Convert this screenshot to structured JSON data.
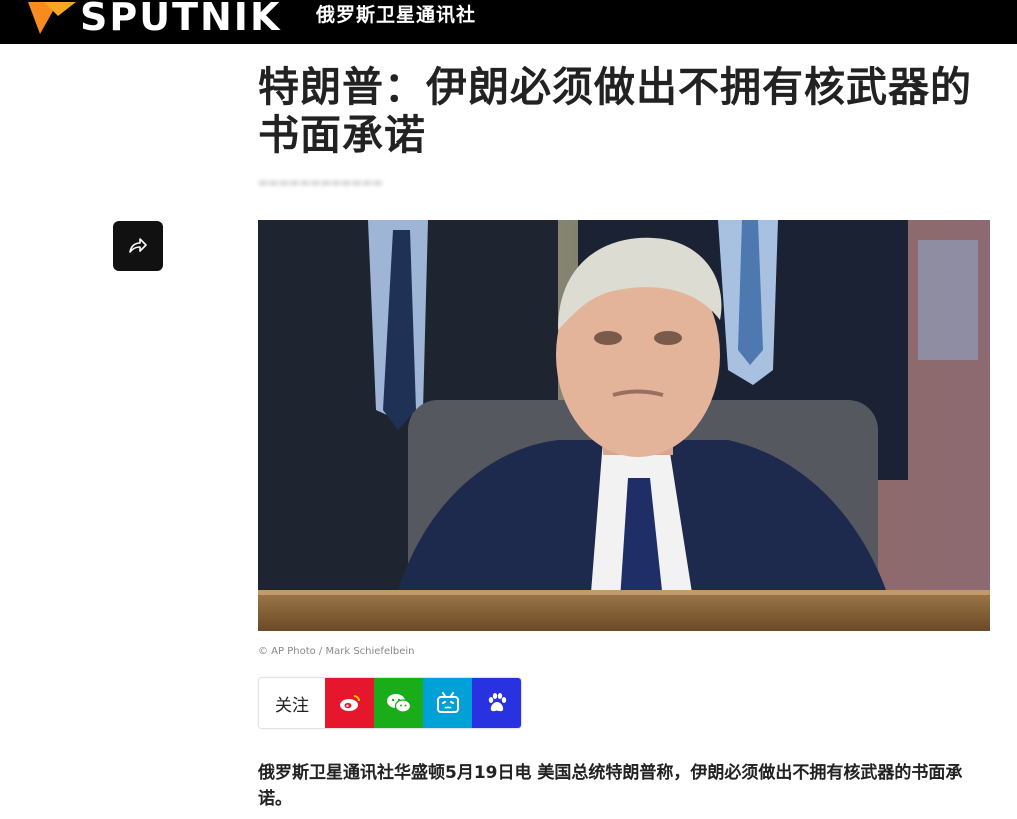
{
  "header": {
    "brand": "SPUTNIK",
    "brand_sub": "俄罗斯卫星通讯社",
    "accent_color": "#F68C1F"
  },
  "article": {
    "title": "特朗普：伊朗必须做出不拥有核武器的书面承诺",
    "photo_credit": "© AP Photo / Mark Schiefelbein",
    "lead": "俄罗斯卫星通讯社华盛顿5月19日电 美国总统特朗普称，伊朗必须做出不拥有核武器的书面承诺。"
  },
  "share": {
    "icon": "share-arrow-icon"
  },
  "social": {
    "follow_label": "关注",
    "buttons": [
      {
        "icon": "weibo-icon",
        "color": "#E6162D"
      },
      {
        "icon": "wechat-icon",
        "color": "#1AAD19"
      },
      {
        "icon": "bilibili-icon",
        "color": "#00A1D6"
      },
      {
        "icon": "baidu-icon",
        "color": "#2932E1"
      }
    ]
  }
}
